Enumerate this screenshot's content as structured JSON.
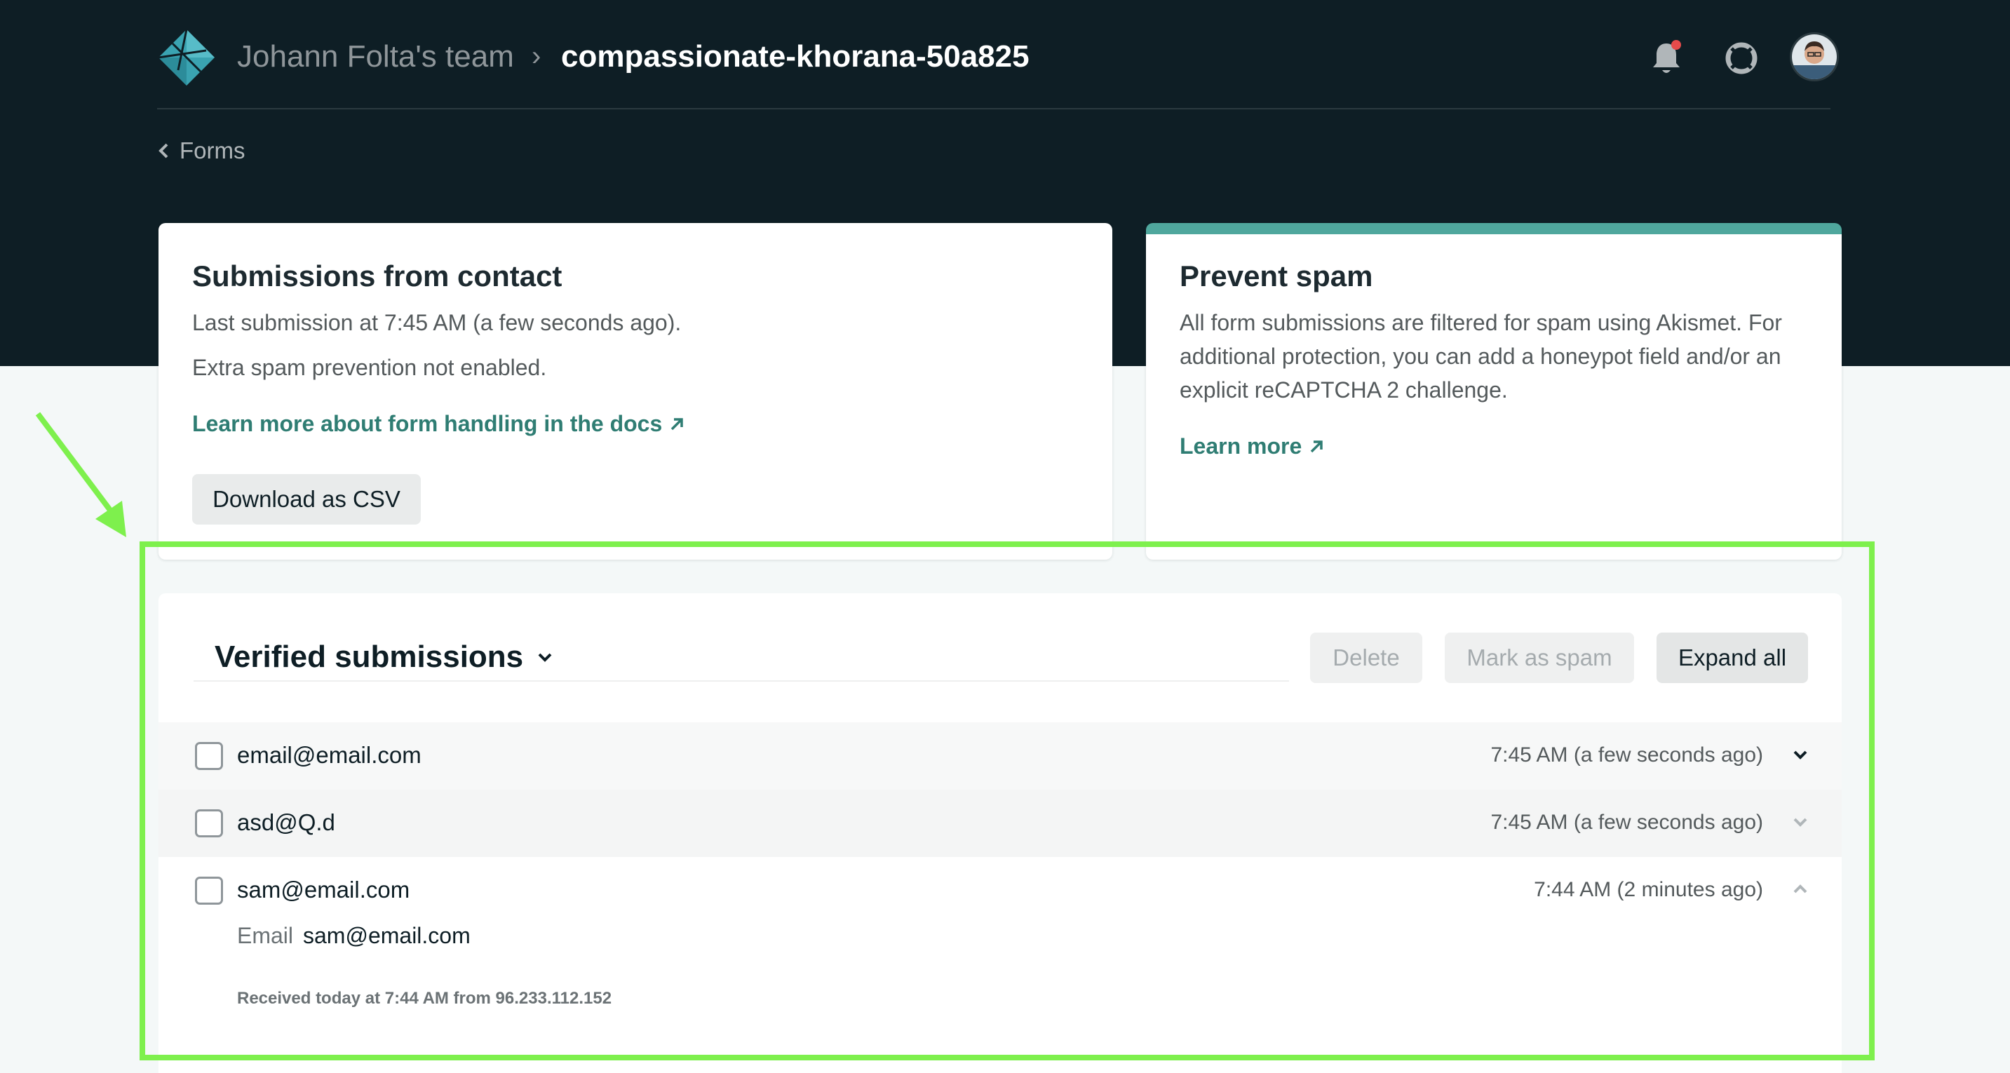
{
  "header": {
    "team_name": "Johann Folta's team",
    "separator": "›",
    "site_name": "compassionate-khorana-50a825",
    "notification_dot_color": "#e64b4b",
    "icons": [
      "netlify-logo-icon",
      "bell-icon",
      "lifebuoy-help-icon",
      "user-avatar"
    ]
  },
  "breadcrumb": {
    "back_label": "Forms"
  },
  "submissions_card": {
    "title": "Submissions from contact",
    "last_submission": "Last submission at 7:45 AM (a few seconds ago).",
    "spam_status": "Extra spam prevention not enabled.",
    "docs_link": "Learn more about form handling in the docs",
    "download_button": "Download as CSV"
  },
  "spam_card": {
    "title": "Prevent spam",
    "description_lines": [
      "All form submissions are filtered for spam using Akismet. For",
      "additional protection, you can add a honeypot field and/or an",
      "explicit reCAPTCHA 2 challenge."
    ],
    "learn_more": "Learn more",
    "accent_color": "#4fa79d"
  },
  "submissions_panel": {
    "filter_label": "Verified submissions",
    "buttons": {
      "delete": "Delete",
      "mark_spam": "Mark as spam",
      "expand_all": "Expand all"
    },
    "rows": [
      {
        "email": "email@email.com",
        "time": "7:45 AM (a few seconds ago)",
        "expanded": false
      },
      {
        "email": "asd@Q.d",
        "time": "7:45 AM (a few seconds ago)",
        "expanded": false
      },
      {
        "email": "sam@email.com",
        "time": "7:44 AM (2 minutes ago)",
        "expanded": true
      }
    ],
    "expanded_detail": {
      "field_label": "Email",
      "field_value": "sam@email.com",
      "received": "Received today at 7:44 AM from 96.233.112.152"
    }
  },
  "annotation": {
    "highlight_color": "#7ef04d"
  }
}
